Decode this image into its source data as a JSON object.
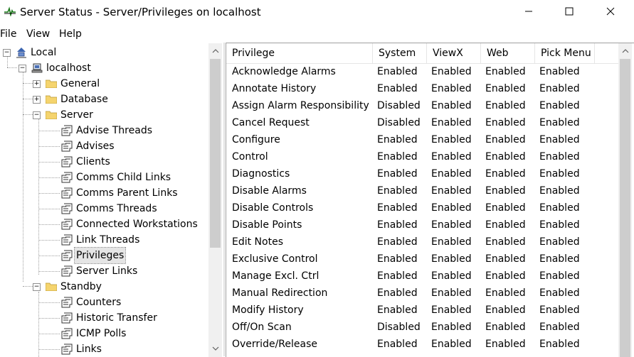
{
  "window": {
    "title": "Server Status - Server/Privileges on localhost",
    "app_icon": "pulse-signal-icon",
    "controls": [
      "minimize-icon",
      "maximize-icon",
      "close-icon"
    ]
  },
  "menu": {
    "file": "File",
    "view": "View",
    "help": "Help"
  },
  "tree": {
    "root": {
      "label": "Local",
      "icon": "network-icon",
      "expander": "−"
    },
    "host": {
      "label": "localhost",
      "icon": "computer-icon",
      "expander": "−"
    },
    "groups": [
      {
        "label": "General",
        "icon": "folder-icon",
        "expander": "+"
      },
      {
        "label": "Database",
        "icon": "folder-icon",
        "expander": "+"
      },
      {
        "label": "Server",
        "icon": "folder-icon",
        "expander": "−"
      }
    ],
    "server_items": [
      "Advise Threads",
      "Advises",
      "Clients",
      "Comms Child Links",
      "Comms Parent Links",
      "Comms Threads",
      "Connected Workstations",
      "Link Threads",
      "Privileges",
      "Server Links"
    ],
    "selected": "Privileges",
    "standby": {
      "label": "Standby",
      "icon": "folder-icon",
      "expander": "−"
    },
    "standby_items": [
      "Counters",
      "Historic Transfer",
      "ICMP Polls",
      "Links"
    ]
  },
  "table": {
    "columns": [
      "Privilege",
      "System",
      "ViewX",
      "Web",
      "Pick Menu"
    ],
    "rows": [
      [
        "Acknowledge Alarms",
        "Enabled",
        "Enabled",
        "Enabled",
        "Enabled"
      ],
      [
        "Annotate History",
        "Enabled",
        "Enabled",
        "Enabled",
        "Enabled"
      ],
      [
        "Assign Alarm Responsibility",
        "Disabled",
        "Enabled",
        "Enabled",
        "Enabled"
      ],
      [
        "Cancel Request",
        "Disabled",
        "Enabled",
        "Enabled",
        "Enabled"
      ],
      [
        "Configure",
        "Enabled",
        "Enabled",
        "Enabled",
        "Enabled"
      ],
      [
        "Control",
        "Enabled",
        "Enabled",
        "Enabled",
        "Enabled"
      ],
      [
        "Diagnostics",
        "Enabled",
        "Enabled",
        "Enabled",
        "Enabled"
      ],
      [
        "Disable Alarms",
        "Enabled",
        "Enabled",
        "Enabled",
        "Enabled"
      ],
      [
        "Disable Controls",
        "Enabled",
        "Enabled",
        "Enabled",
        "Enabled"
      ],
      [
        "Disable Points",
        "Enabled",
        "Enabled",
        "Enabled",
        "Enabled"
      ],
      [
        "Edit Notes",
        "Enabled",
        "Enabled",
        "Enabled",
        "Enabled"
      ],
      [
        "Exclusive Control",
        "Enabled",
        "Enabled",
        "Enabled",
        "Enabled"
      ],
      [
        "Manage Excl. Ctrl",
        "Enabled",
        "Enabled",
        "Enabled",
        "Enabled"
      ],
      [
        "Manual Redirection",
        "Enabled",
        "Enabled",
        "Enabled",
        "Enabled"
      ],
      [
        "Modify History",
        "Enabled",
        "Enabled",
        "Enabled",
        "Enabled"
      ],
      [
        "Off/On Scan",
        "Disabled",
        "Enabled",
        "Enabled",
        "Enabled"
      ],
      [
        "Override/Release",
        "Enabled",
        "Enabled",
        "Enabled",
        "Enabled"
      ]
    ]
  },
  "colors": {
    "selection": "#e5e5e5",
    "folder": "#f5d46e",
    "scroll_track": "#f0f0f0",
    "scroll_thumb": "#cdcdcd"
  }
}
